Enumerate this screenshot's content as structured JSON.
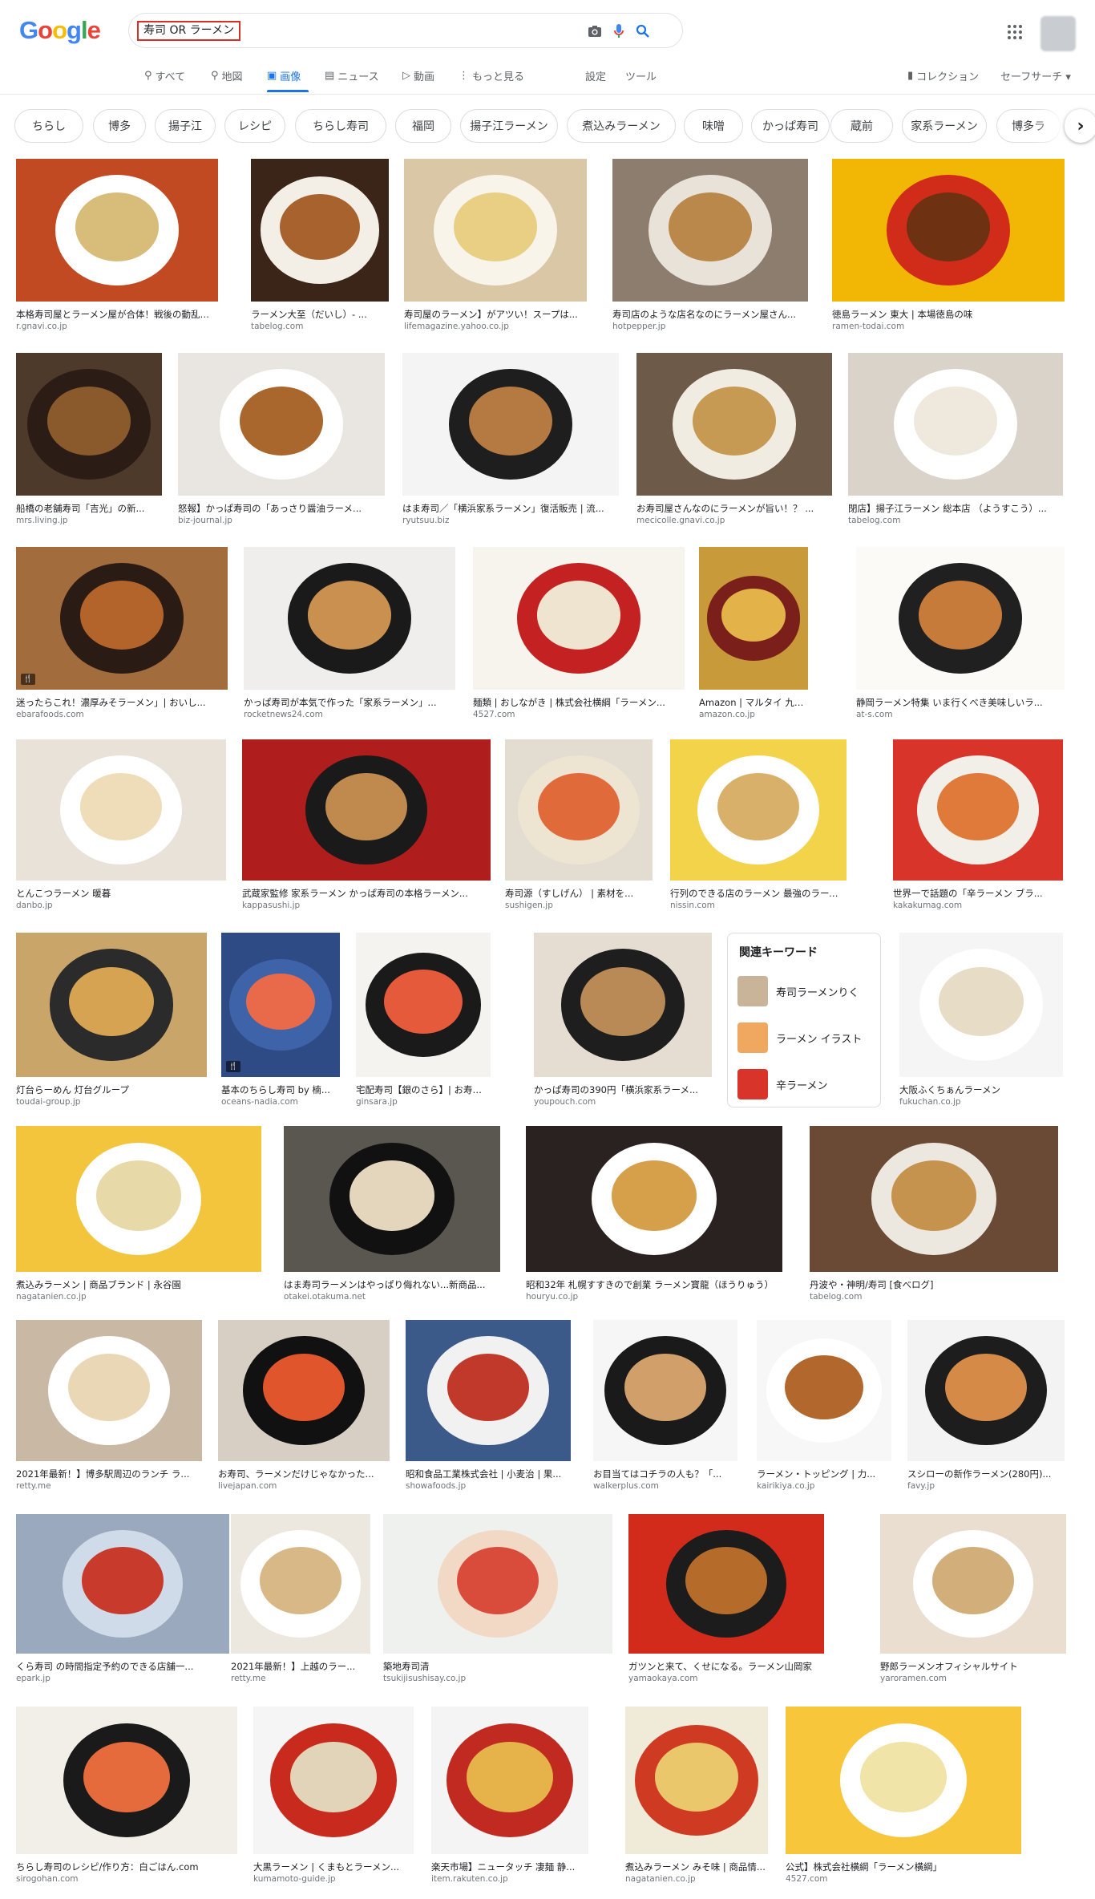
{
  "logo": {
    "text": "Google",
    "colors": [
      "#4285f4",
      "#ea4335",
      "#fbbc05",
      "#4285f4",
      "#34a853",
      "#ea4335"
    ]
  },
  "search": {
    "query": "寿司 OR ラーメン"
  },
  "tabs": [
    {
      "label": "すべて",
      "icon": "search-icon"
    },
    {
      "label": "地図",
      "icon": "pin-icon"
    },
    {
      "label": "画像",
      "icon": "image-icon"
    },
    {
      "label": "ニュース",
      "icon": "news-icon"
    },
    {
      "label": "動画",
      "icon": "play-icon"
    },
    {
      "label": "もっと見る",
      "icon": "more-icon"
    }
  ],
  "tools": {
    "settings": "設定",
    "tools": "ツール",
    "collections": "コレクション",
    "safesearch": "セーフサーチ ▾"
  },
  "chips": [
    "ちらし",
    "博多",
    "揚子江",
    "レシピ",
    "ちらし寿司",
    "福岡",
    "揚子江ラーメン",
    "煮込みラーメン",
    "味噌",
    "かっぱ寿司",
    "蔵前",
    "家系ラーメン",
    "博多ラ"
  ],
  "results": [
    {
      "caption": "本格寿司屋とラーメン屋が合体！戦後の動乱を ...",
      "source": "r.gnavi.co.jp",
      "color": "#c24a22",
      "bowl": "#ffffff",
      "soup": "#d8bc7a"
    },
    {
      "caption": "ラーメン大至（だいし）- ...",
      "source": "tabelog.com",
      "color": "#3b2418",
      "bowl": "#f4efe6",
      "soup": "#a8622e"
    },
    {
      "caption": "寿司屋のラーメン】がアツい！スープは...",
      "source": "lifemagazine.yahoo.co.jp",
      "color": "#d9c7a6",
      "bowl": "#f8f4ea",
      "soup": "#e9cf84"
    },
    {
      "caption": "寿司店のような店名なのにラーメン屋さん...",
      "source": "hotpepper.jp",
      "color": "#8c7d6e",
      "bowl": "#e8e2d8",
      "soup": "#b9884a"
    },
    {
      "caption": "徳島ラーメン 東大 | 本場徳島の味",
      "source": "ramen-todai.com",
      "color": "#f2b705",
      "bowl": "#d12c1a",
      "soup": "#6e3112"
    },
    {
      "caption": "船橋の老舗寿司「吉光」の新...",
      "source": "mrs.living.jp",
      "color": "#4e3a2b",
      "bowl": "#2b1d16",
      "soup": "#8a5a2c"
    },
    {
      "caption": "怒報】かっぱ寿司の「あっさり醤油ラーメ...",
      "source": "biz-journal.jp",
      "color": "#e9e6e1",
      "bowl": "#ffffff",
      "soup": "#a9662d"
    },
    {
      "caption": "はま寿司／「横浜家系ラーメン」復活販売 | 流...",
      "source": "ryutsuu.biz",
      "color": "#f4f4f4",
      "bowl": "#1e1e1e",
      "soup": "#b57a42"
    },
    {
      "caption": "お寿司屋さんなのにラーメンが旨い！？ ...",
      "source": "mecicolle.gnavi.co.jp",
      "color": "#6d5a48",
      "bowl": "#f1ece2",
      "soup": "#c69a52"
    },
    {
      "caption": "閉店】揚子江ラーメン 総本店 （ようすこう）...",
      "source": "tabelog.com",
      "color": "#d9d3ca",
      "bowl": "#ffffff",
      "soup": "#efe9dd"
    },
    {
      "caption": "迷ったらこれ！濃厚みそラーメン」| おいし...",
      "source": "ebarafoods.com",
      "color": "#a36c3c",
      "bowl": "#2a1c14",
      "soup": "#b3642a"
    },
    {
      "caption": "かっぱ寿司が本気で作った「家系ラーメン」...",
      "source": "rocketnews24.com",
      "color": "#efeeec",
      "bowl": "#1a1a1a",
      "soup": "#c99050"
    },
    {
      "caption": "麺類 | おしながき | 株式会社横綱「ラーメン...",
      "source": "4527.com",
      "color": "#f7f4ee",
      "bowl": "#c42222",
      "soup": "#efe4cf"
    },
    {
      "caption": "Amazon | マルタイ 九州 ご当...",
      "source": "amazon.co.jp",
      "color": "#c99a3a",
      "bowl": "#7b1f1a",
      "soup": "#e3b34a"
    },
    {
      "caption": "静岡ラーメン特集 いま行くべき美味しいラ...",
      "source": "at-s.com",
      "color": "#fbfaf7",
      "bowl": "#202020",
      "soup": "#c67b3a"
    },
    {
      "caption": "とんこつラーメン 暖暮",
      "source": "danbo.jp",
      "color": "#e8e2d8",
      "bowl": "#ffffff",
      "soup": "#efdcb8"
    },
    {
      "caption": "武蔵家監修 家系ラーメン かっぱ寿司の本格ラーメン...",
      "source": "kappasushi.jp",
      "color": "#b01d1d",
      "bowl": "#1a1a1a",
      "soup": "#c08a4e"
    },
    {
      "caption": "寿司源（すしげん） | 素材を...",
      "source": "sushigen.jp",
      "color": "#e3dcd0",
      "bowl": "#ede4d2",
      "soup": "#e06a3a"
    },
    {
      "caption": "行列のできる店のラーメン 最強のラーメン ...",
      "source": "nissin.com",
      "color": "#f3d34a",
      "bowl": "#ffffff",
      "soup": "#d9b06a"
    },
    {
      "caption": "世界一で話題の「辛ラーメン ブラ...",
      "source": "kakakumag.com",
      "color": "#d8342a",
      "bowl": "#f2efe8",
      "soup": "#e07a3a"
    },
    {
      "caption": "灯台らーめん 灯台グループ",
      "source": "toudai-group.jp",
      "color": "#c9a56a",
      "bowl": "#2b2b2b",
      "soup": "#d5a351"
    },
    {
      "caption": "基本のちらし寿司 by 楠...",
      "source": "oceans-nadia.com",
      "color": "#2f4b86",
      "bowl": "#3f63a8",
      "soup": "#e86a4a"
    },
    {
      "caption": "宅配寿司【銀のさら】| お寿司の...",
      "source": "ginsara.jp",
      "color": "#f5f3f0",
      "bowl": "#1a1a1a",
      "soup": "#e65a3c"
    },
    {
      "caption": "かっぱ寿司の390円「横浜家系ラーメ...",
      "source": "youpouch.com",
      "color": "#e6ddd2",
      "bowl": "#1e1e1e",
      "soup": "#b98a56"
    },
    {
      "caption": "大阪ふくちぁんラーメン",
      "source": "fukuchan.co.jp",
      "color": "#f5f5f5",
      "bowl": "#ffffff",
      "soup": "#e7dcc6"
    },
    {
      "caption": "煮込みラーメン | 商品ブランド | 永谷園",
      "source": "nagatanien.co.jp",
      "color": "#f2c53d",
      "bowl": "#ffffff",
      "soup": "#e8d9a8"
    },
    {
      "caption": "はま寿司ラーメンはやっぱり侮れない...新商品...",
      "source": "otakei.otakuma.net",
      "color": "#5a5650",
      "bowl": "#111111",
      "soup": "#e3d6bd"
    },
    {
      "caption": "昭和32年 札幌すすきので創業 ラーメン寳龍（ほうりゅう）",
      "source": "houryu.co.jp",
      "color": "#2a2220",
      "bowl": "#ffffff",
      "soup": "#d6a04a"
    },
    {
      "caption": "丹波や・神明/寿司 [食べログ]",
      "source": "tabelog.com",
      "color": "#6a4a34",
      "bowl": "#ede8df",
      "soup": "#c6934e"
    },
    {
      "caption": "2021年最新！】博多駅周辺のランチ ラ...",
      "source": "retty.me",
      "color": "#c8b8a4",
      "bowl": "#ffffff",
      "soup": "#ead7b5"
    },
    {
      "caption": "お寿司、ラーメンだけじゃなかった...",
      "source": "livejapan.com",
      "color": "#d7cfc4",
      "bowl": "#111111",
      "soup": "#e1552c"
    },
    {
      "caption": "昭和食品工業株式会社 | 小麦治 | 果...",
      "source": "showafoods.jp",
      "color": "#3b5a8a",
      "bowl": "#f1f1f1",
      "soup": "#c0392b"
    },
    {
      "caption": "お目当てはコチラの人も？「...",
      "source": "walkerplus.com",
      "color": "#f6f6f6",
      "bowl": "#1a1a1a",
      "soup": "#d1a06a"
    },
    {
      "caption": "ラーメン・トッピング | 力...",
      "source": "kairikiya.co.jp",
      "color": "#f7f7f7",
      "bowl": "#ffffff",
      "soup": "#b2672d"
    },
    {
      "caption": "スシローの新作ラーメン(280円)...",
      "source": "favy.jp",
      "color": "#f3f3f3",
      "bowl": "#1d1d1d",
      "soup": "#d58a48"
    },
    {
      "caption": "くら寿司 の時間指定予約のできる店舗一...",
      "source": "epark.jp",
      "color": "#9aa9bd",
      "bowl": "#cfdbe8",
      "soup": "#c83a2c"
    },
    {
      "caption": "2021年最新！】上越のラー...",
      "source": "retty.me",
      "color": "#ece7df",
      "bowl": "#ffffff",
      "soup": "#d9b887"
    },
    {
      "caption": "築地寿司清",
      "source": "tsukijisushisay.co.jp",
      "color": "#eef1ee",
      "bowl": "#f2d9c6",
      "soup": "#d94b3a"
    },
    {
      "caption": "ガツンと来て、くせになる。ラーメン山岡家",
      "source": "yamaokaya.com",
      "color": "#d22b1b",
      "bowl": "#1c1c1c",
      "soup": "#b56b2a"
    },
    {
      "caption": "野郎ラーメンオフィシャルサイト",
      "source": "yaroramen.com",
      "color": "#e9ded0",
      "bowl": "#ffffff",
      "soup": "#d1ae7a"
    },
    {
      "caption": "ちらし寿司のレシピ/作り方：白ごはん.com",
      "source": "sirogohan.com",
      "color": "#f2efe9",
      "bowl": "#1a1a1a",
      "soup": "#e66b3c"
    },
    {
      "caption": "大黒ラーメン | くまもとラーメン...",
      "source": "kumamoto-guide.jp",
      "color": "#f5f5f5",
      "bowl": "#c82a1e",
      "soup": "#e2d4b8"
    },
    {
      "caption": "楽天市場】ニュータッチ 凄麺 静...",
      "source": "item.rakuten.co.jp",
      "color": "#f4f4f4",
      "bowl": "#c12a20",
      "soup": "#e6b24a"
    },
    {
      "caption": "煮込みラーメン みそ味 | 商品情...",
      "source": "nagatanien.co.jp",
      "color": "#f0ead8",
      "bowl": "#cf3a22",
      "soup": "#e9c76a"
    },
    {
      "caption": "公式】株式会社横綱「ラーメン横綱」",
      "source": "4527.com",
      "color": "#f7c63a",
      "bowl": "#ffffff",
      "soup": "#f1e4a8"
    }
  ],
  "related": {
    "title": "関連キーワード",
    "items": [
      {
        "label": "寿司ラーメンりく",
        "color": "#c9b49a"
      },
      {
        "label": "ラーメン イラスト",
        "color": "#f0a860"
      },
      {
        "label": "辛ラーメン",
        "color": "#d8342a"
      }
    ]
  },
  "badges": {
    "recipe": "🍴"
  }
}
